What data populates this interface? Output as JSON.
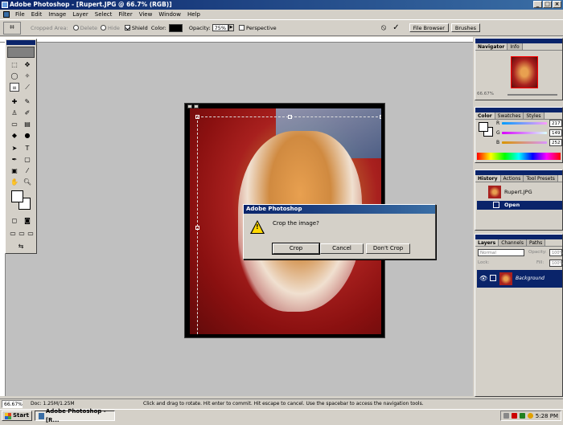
{
  "window": {
    "title": "Adobe Photoshop - [Rupert.JPG @ 66.7% (RGB)]",
    "min": "_",
    "max": "□",
    "close": "×"
  },
  "menu": [
    "File",
    "Edit",
    "Image",
    "Layer",
    "Select",
    "Filter",
    "View",
    "Window",
    "Help"
  ],
  "options": {
    "cropped_area_label": "Cropped Area:",
    "delete_label": "Delete",
    "hide_label": "Hide",
    "shield_label": "Shield",
    "color_label": "Color:",
    "opacity_label": "Opacity:",
    "opacity_value": "75%",
    "perspective_label": "Perspective",
    "file_browser_tab": "File Browser",
    "brushes_tab": "Brushes",
    "cancel_icon": "⦸",
    "commit_icon": "✓"
  },
  "dialog": {
    "title": "Adobe Photoshop",
    "message": "Crop the image?",
    "warning_icon": "!",
    "buttons": {
      "crop": "Crop",
      "cancel": "Cancel",
      "dont_crop": "Don't Crop"
    }
  },
  "panels": {
    "navigator": {
      "tabs": [
        "Navigator",
        "Info"
      ],
      "zoom": "66.67%"
    },
    "color": {
      "tabs": [
        "Color",
        "Swatches",
        "Styles"
      ],
      "r_label": "R",
      "g_label": "G",
      "b_label": "B",
      "r": "217",
      "g": "149",
      "b": "252"
    },
    "history": {
      "tabs": [
        "History",
        "Actions",
        "Tool Presets"
      ],
      "items": [
        {
          "label": "Rupert.JPG"
        },
        {
          "label": "Open"
        }
      ]
    },
    "layers": {
      "tabs": [
        "Layers",
        "Channels",
        "Paths"
      ],
      "blend": "Normal",
      "opacity_label": "Opacity:",
      "opacity": "100%",
      "lock_label": "Lock:",
      "fill_label": "Fill:",
      "fill": "100%",
      "layer_name": "Background"
    }
  },
  "status": {
    "zoom": "66.67%",
    "doc": "Doc: 1.25M/1.25M",
    "hint": "Click and drag to rotate. Hit enter to commit. Hit escape to cancel. Use the spacebar to access the navigation tools."
  },
  "taskbar": {
    "start": "Start",
    "task": "Adobe Photoshop - [R...",
    "time": "5:28 PM"
  }
}
